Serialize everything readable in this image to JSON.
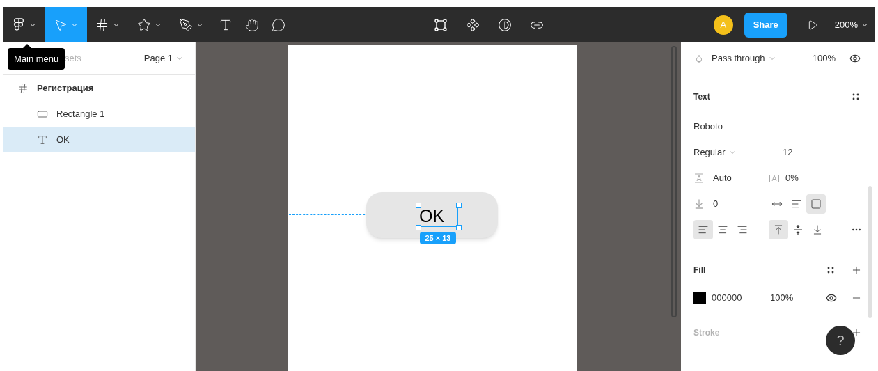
{
  "toolbar": {
    "tools": [
      {
        "kind": "main-menu",
        "selected": false,
        "menu": true
      },
      {
        "kind": "move",
        "selected": true,
        "menu": true
      },
      {
        "kind": "frame",
        "selected": false,
        "menu": true
      },
      {
        "kind": "shape",
        "selected": false,
        "menu": true
      },
      {
        "kind": "pen",
        "selected": false,
        "menu": true
      },
      {
        "kind": "text",
        "selected": false,
        "menu": false
      },
      {
        "kind": "hand",
        "selected": false,
        "menu": false
      },
      {
        "kind": "comment",
        "selected": false,
        "menu": false
      }
    ],
    "center_tools": [
      {
        "kind": "frame-selection"
      },
      {
        "kind": "component"
      },
      {
        "kind": "mask"
      },
      {
        "kind": "link"
      }
    ],
    "avatar": "A",
    "share": "Share",
    "zoom": "200%"
  },
  "tooltip": "Main menu",
  "left_panel": {
    "tab_fragment": "sets",
    "page": "Page 1",
    "layers": [
      {
        "name": "Регистрация",
        "kind": "frame",
        "selected": false,
        "children": [
          {
            "name": "Rectangle 1",
            "kind": "rectangle",
            "selected": false
          },
          {
            "name": "OK",
            "kind": "text",
            "selected": true
          }
        ]
      }
    ]
  },
  "canvas": {
    "button_label": "OK",
    "size_label": "25 × 13"
  },
  "right_panel": {
    "blend": "Pass through",
    "opacity": "100%",
    "text": {
      "title": "Text",
      "font": "Roboto",
      "style": "Regular",
      "size": "12",
      "line_height": "Auto",
      "letter_spacing": "0%",
      "paragraph_spacing": "0",
      "resizing": [
        {
          "kind": "auto-width",
          "selected": false
        },
        {
          "kind": "auto-height",
          "selected": false
        },
        {
          "kind": "fixed",
          "selected": true
        }
      ],
      "align": [
        {
          "kind": "left",
          "selected": true
        },
        {
          "kind": "center",
          "selected": false
        },
        {
          "kind": "right",
          "selected": false
        }
      ],
      "vertical_align": [
        {
          "kind": "top",
          "selected": true
        },
        {
          "kind": "middle",
          "selected": false
        },
        {
          "kind": "bottom",
          "selected": false
        }
      ]
    },
    "fill": {
      "title": "Fill",
      "color": "#000000",
      "hex": "000000",
      "opacity": "100%"
    },
    "stroke": {
      "title": "Stroke"
    },
    "help": "?"
  }
}
